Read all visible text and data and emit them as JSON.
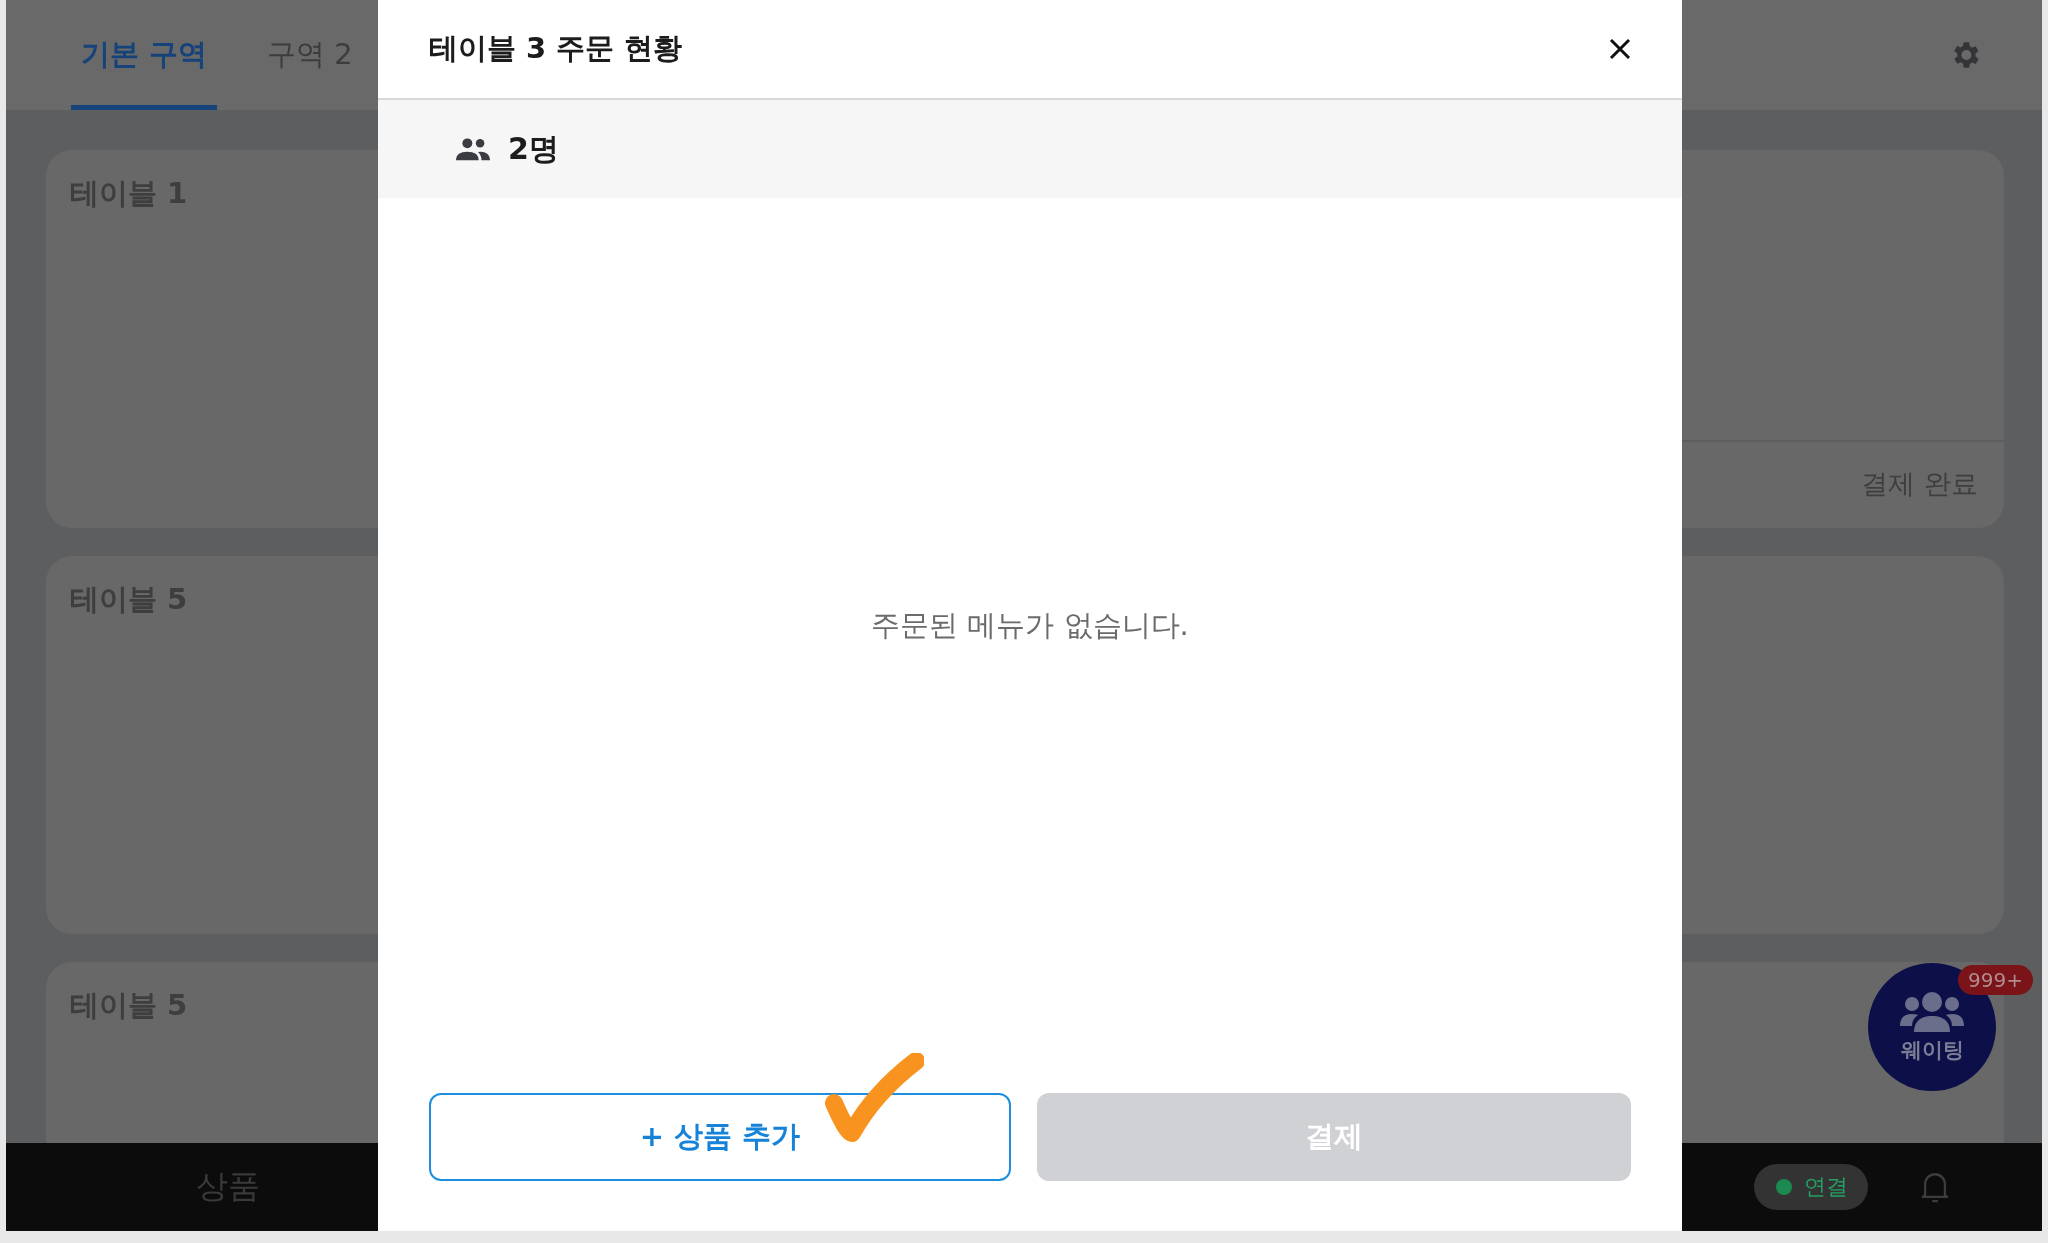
{
  "tabs": [
    {
      "label": "기본 구역",
      "selected": true
    },
    {
      "label": "구역 2",
      "selected": false
    }
  ],
  "tables": [
    {
      "kind": "titled",
      "title": "테이블 1"
    },
    {
      "kind": "paid",
      "status": "결제 완료"
    },
    {
      "kind": "titled",
      "title": "테이블 5"
    },
    {
      "kind": "blank"
    },
    {
      "kind": "titled",
      "title": "테이블 5"
    },
    {
      "kind": "blank"
    }
  ],
  "bottom_bar": {
    "menu": "상품",
    "connection": "연결"
  },
  "waiting_button": {
    "label": "웨이팅",
    "badge": "999+"
  },
  "dialog": {
    "title": "테이블 3 주문 현황",
    "guests": "2명",
    "empty_message": "주문된 메뉴가 없습니다.",
    "add_button": "+ 상품 추가",
    "pay_button": {
      "label": "결제",
      "disabled": true
    }
  }
}
